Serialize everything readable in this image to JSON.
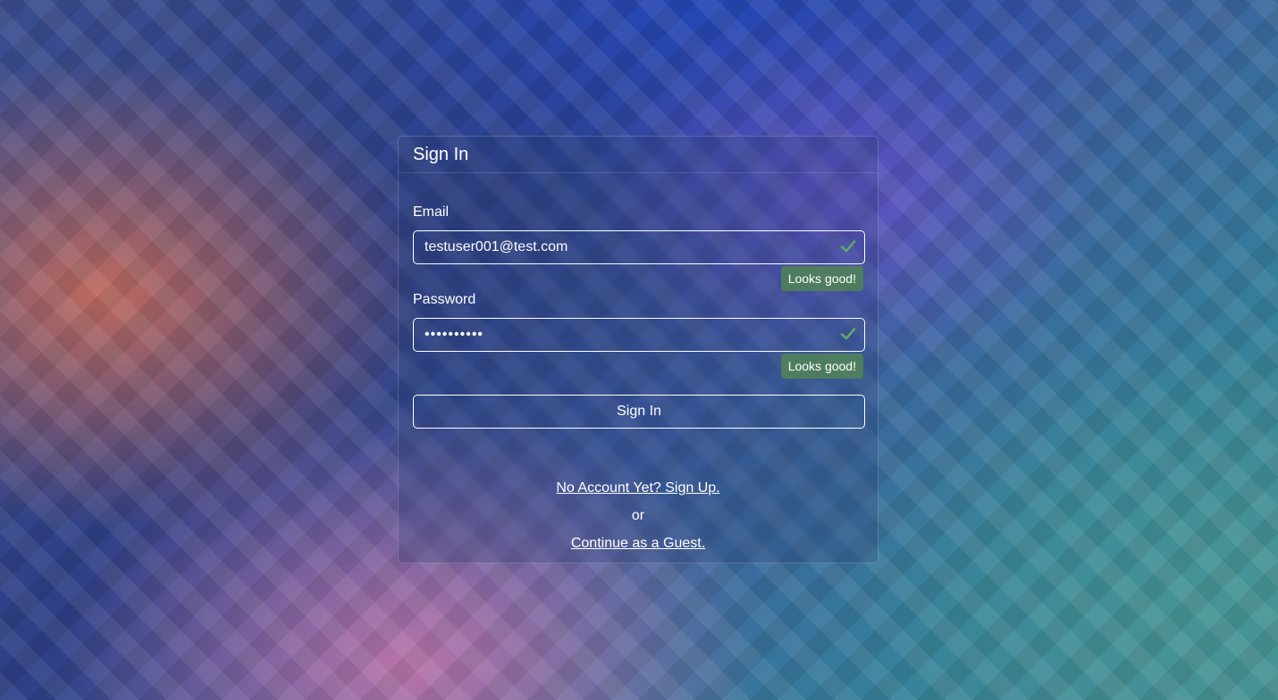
{
  "card": {
    "title": "Sign In"
  },
  "form": {
    "email": {
      "label": "Email",
      "value": "testuser001@test.com",
      "feedback": "Looks good!"
    },
    "password": {
      "label": "Password",
      "value": "••••••••••",
      "feedback": "Looks good!"
    },
    "submit_label": "Sign In"
  },
  "links": {
    "signup_label": "No Account Yet? Sign Up.",
    "or_label": "or",
    "guest_label": "Continue as a Guest."
  },
  "icons": {
    "valid": "check-icon"
  },
  "colors": {
    "valid": "#5fa86a",
    "feedback_bg": "#50825a",
    "text": "#ffffff"
  }
}
